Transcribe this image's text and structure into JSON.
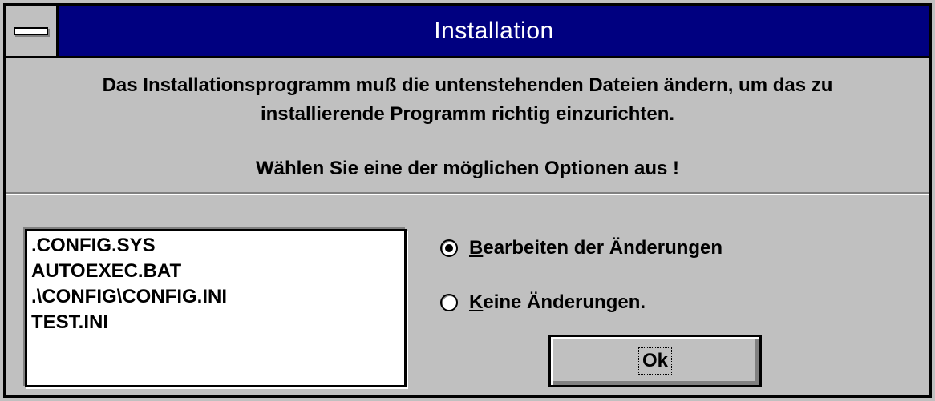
{
  "window": {
    "title": "Installation",
    "system_menu_icon": "system-menu-icon"
  },
  "message": {
    "line1": "Das Installationsprogramm muß die untenstehenden Dateien ändern, um das zu",
    "line2": "installierende Programm richtig einzurichten.",
    "line3": "Wählen Sie eine der möglichen Optionen aus !"
  },
  "files": [
    ".CONFIG.SYS",
    "AUTOEXEC.BAT",
    ".\\CONFIG\\CONFIG.INI",
    "TEST.INI"
  ],
  "options": [
    {
      "mnemonic": "B",
      "rest": "earbeiten der Änderungen",
      "selected": true
    },
    {
      "mnemonic": "K",
      "rest": "eine Änderungen.",
      "selected": false
    }
  ],
  "buttons": {
    "ok_label": "Ok"
  },
  "colors": {
    "titlebar": "#000080",
    "face": "#c0c0c0",
    "text": "#000000"
  }
}
